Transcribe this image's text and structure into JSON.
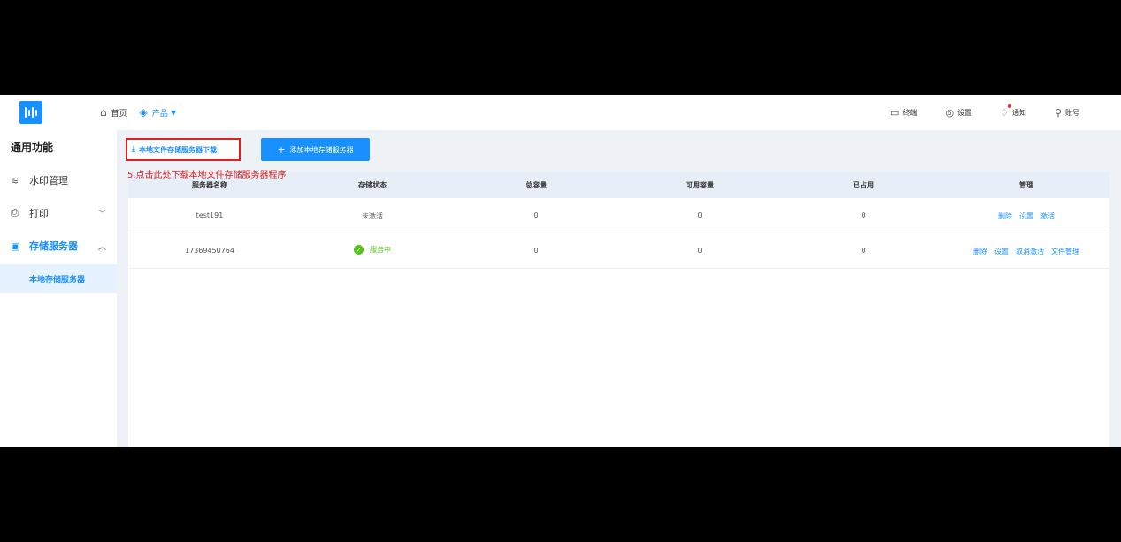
{
  "header": {
    "nav": [
      {
        "icon": "home-icon",
        "label": "首页"
      },
      {
        "icon": "layers-icon",
        "label": "产品"
      }
    ],
    "right": [
      {
        "icon": "terminal-icon",
        "label": "终端"
      },
      {
        "icon": "settings-icon",
        "label": "设置"
      },
      {
        "icon": "bell-icon",
        "label": "通知"
      },
      {
        "icon": "account-icon",
        "label": "账号"
      }
    ]
  },
  "sidebar": {
    "title": "通用功能",
    "items": [
      {
        "icon": "watermark-icon",
        "label": "水印管理"
      },
      {
        "icon": "printer-icon",
        "label": "打印"
      },
      {
        "icon": "save-icon",
        "label": "存储服务器"
      }
    ],
    "sub_items": [
      {
        "label": "本地存储服务器"
      }
    ]
  },
  "toolbar": {
    "download_label": "本地文件存储服务器下载",
    "add_label": "添加本地存储服务器"
  },
  "annotation": "5.点击此处下载本地文件存储服务器程序",
  "table": {
    "headers": [
      "服务器名称",
      "存储状态",
      "总容量",
      "可用容量",
      "已占用",
      "管理"
    ],
    "rows": [
      {
        "name": "test191",
        "status": "未激活",
        "total": "0",
        "available": "0",
        "used": "0",
        "actions": [
          "删除",
          "设置",
          "激活"
        ]
      },
      {
        "name": "17369450764",
        "status": "服务中",
        "total": "0",
        "available": "0",
        "used": "0",
        "actions": [
          "删除",
          "设置",
          "取消激活",
          "文件管理"
        ]
      }
    ]
  },
  "colors": {
    "accent": "#1890ff",
    "success": "#52c41a",
    "annotation": "#e02020"
  }
}
